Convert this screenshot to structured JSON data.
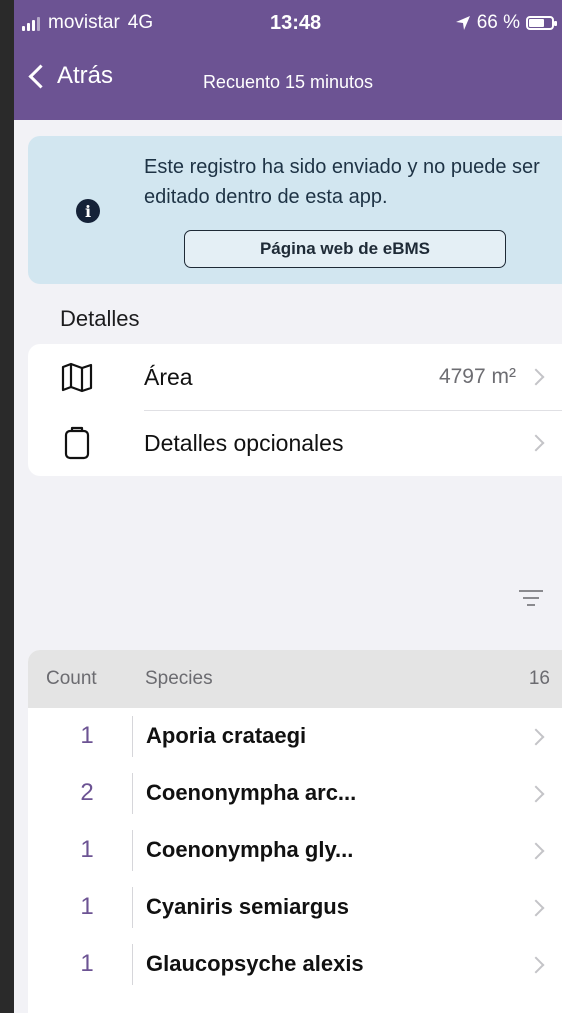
{
  "status_bar": {
    "carrier": "movistar",
    "network": "4G",
    "time": "13:48",
    "battery": "66 %",
    "battery_level": 0.66
  },
  "nav": {
    "back_label": "Atrás",
    "title": "Recuento 15 minutos"
  },
  "banner": {
    "text": "Este registro ha sido enviado y no puede ser editado dentro de esta app.",
    "button_label": "Página web de eBMS"
  },
  "details": {
    "section_title": "Detalles",
    "rows": [
      {
        "label": "Área",
        "value": "4797 m²",
        "icon": "map-icon"
      },
      {
        "label": "Detalles opcionales",
        "value": "",
        "icon": "clipboard-icon"
      }
    ]
  },
  "species_list": {
    "header_count": "Count",
    "header_species": "Species",
    "header_total": "16",
    "items": [
      {
        "count": "1",
        "name": "Aporia crataegi"
      },
      {
        "count": "2",
        "name": "Coenonympha arc..."
      },
      {
        "count": "1",
        "name": "Coenonympha gly..."
      },
      {
        "count": "1",
        "name": "Cyaniris semiargus"
      },
      {
        "count": "1",
        "name": "Glaucopsyche alexis"
      }
    ]
  },
  "colors": {
    "header": "#6c5393",
    "banner": "#d2e6f0",
    "count_text": "#6c5393"
  }
}
